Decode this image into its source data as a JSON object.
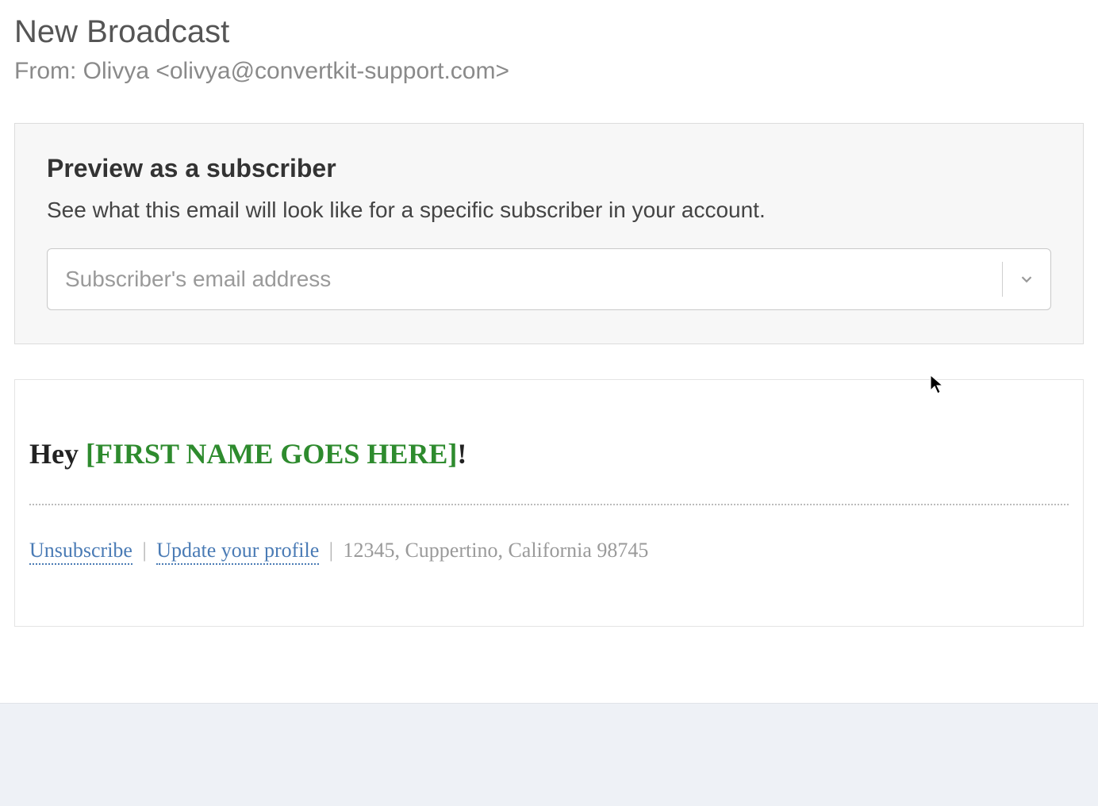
{
  "header": {
    "title": "New Broadcast",
    "from_line": "From: Olivya <olivya@convertkit-support.com>"
  },
  "preview": {
    "title": "Preview as a subscriber",
    "description": "See what this email will look like for a specific subscriber in your account.",
    "placeholder": "Subscriber's email address"
  },
  "email": {
    "greeting_prefix": "Hey ",
    "greeting_placeholder": "[FIRST NAME GOES HERE]",
    "greeting_suffix": "!",
    "footer": {
      "unsubscribe": "Unsubscribe",
      "update": "Update your profile",
      "separator": "|",
      "address": "12345, Cuppertino, California 98745"
    }
  }
}
